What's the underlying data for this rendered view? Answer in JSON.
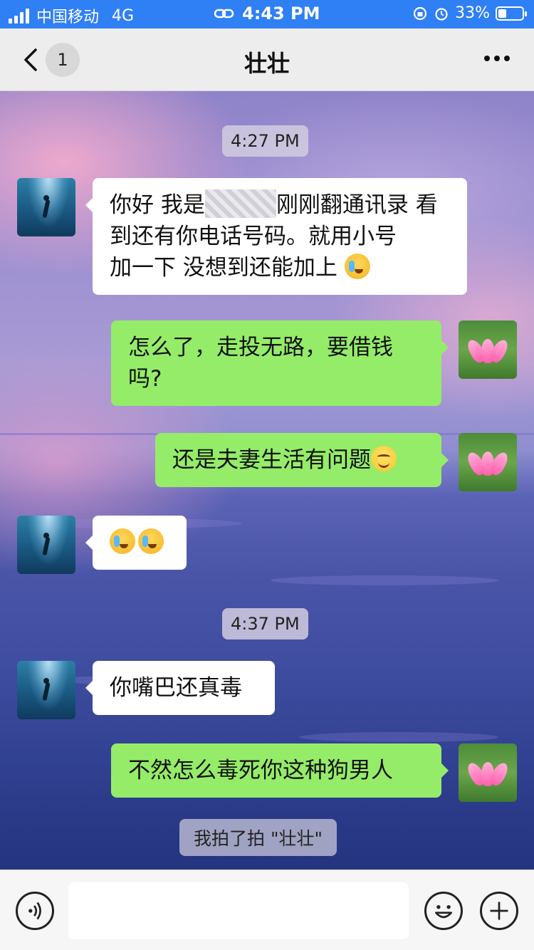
{
  "status_bar": {
    "carrier": "中国移动",
    "network": "4G",
    "time": "4:43 PM",
    "battery": "33%",
    "battery_level": 0.33
  },
  "nav": {
    "unread_count": "1",
    "title": "壮壮"
  },
  "messages": [
    {
      "type": "time",
      "text": "4:27 PM"
    },
    {
      "type": "incoming",
      "lines": [
        "你好 我是",
        "刚刚翻通讯录 看",
        "到还有你电话号码。就用小号",
        "加一下 没想到还能加上"
      ],
      "emoji": [
        "crying-laughing"
      ],
      "redacted": true
    },
    {
      "type": "outgoing",
      "lines": [
        "怎么了，走投无路，要借钱",
        "吗?"
      ]
    },
    {
      "type": "outgoing",
      "lines": [
        "还是夫妻生活有问题"
      ],
      "emoji": [
        "smile"
      ]
    },
    {
      "type": "incoming",
      "lines": [],
      "emoji": [
        "crying-laughing",
        "crying-laughing"
      ]
    },
    {
      "type": "time",
      "text": "4:37 PM"
    },
    {
      "type": "incoming",
      "lines": [
        "你嘴巴还真毒"
      ]
    },
    {
      "type": "outgoing",
      "lines": [
        "不然怎么毒死你这种狗男人"
      ]
    },
    {
      "type": "system",
      "text": "我拍了拍 \"壮壮\""
    }
  ],
  "input_bar": {
    "icons": [
      "voice-icon",
      "emoji-icon",
      "plus-icon"
    ],
    "input_value": ""
  },
  "colors": {
    "status_bar": "#2f7ff5",
    "outgoing_bubble": "#95ec69",
    "incoming_bubble": "#ffffff"
  }
}
